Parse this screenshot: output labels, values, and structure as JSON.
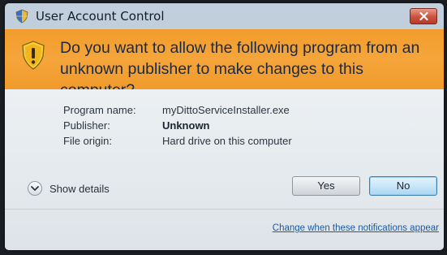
{
  "window": {
    "title": "User Account Control",
    "title_icon": "uac-shield-icon",
    "close_icon": "close-icon"
  },
  "banner": {
    "question": "Do you want to allow the following program from an unknown publisher to make changes to this computer?",
    "icon": "warning-shield-icon",
    "color": "#f29c2c"
  },
  "info": [
    {
      "label": "Program name:",
      "value": "myDittoServiceInstaller.exe",
      "bold": false
    },
    {
      "label": "Publisher:",
      "value": "Unknown",
      "bold": true
    },
    {
      "label": "File origin:",
      "value": "Hard drive on this computer",
      "bold": false
    }
  ],
  "details": {
    "label": "Show details",
    "icon": "chevron-down-icon"
  },
  "buttons": {
    "yes": "Yes",
    "no": "No"
  },
  "footer": {
    "link": "Change when these notifications appear"
  }
}
